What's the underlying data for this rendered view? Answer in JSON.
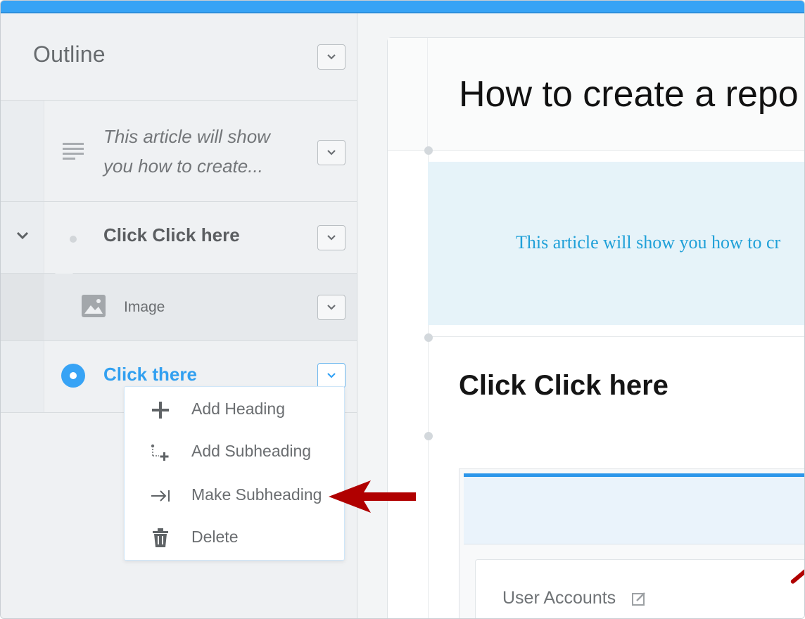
{
  "sidebar": {
    "title": "Outline",
    "rows": [
      {
        "label": "This article will show you how to create...",
        "icon": "paragraph-lines-icon"
      },
      {
        "label": "Click Click here",
        "icon": "bullet-dot-icon",
        "expanded": true
      },
      {
        "label": "Image",
        "icon": "image-icon"
      },
      {
        "label": "Click there",
        "icon": "radio-selected-icon",
        "selected": true
      }
    ]
  },
  "menu": {
    "items": [
      {
        "label": "Add Heading",
        "icon": "plus-icon"
      },
      {
        "label": "Add Subheading",
        "icon": "add-subheading-icon"
      },
      {
        "label": "Make Subheading",
        "icon": "indent-arrow-icon"
      },
      {
        "label": "Delete",
        "icon": "trash-icon"
      }
    ]
  },
  "document": {
    "title": "How to create a repo",
    "intro": "This article will show you how to cr",
    "heading": "Click Click here",
    "image_card_label": "User Accounts"
  },
  "colors": {
    "accent": "#37a3f5",
    "selected_text": "#32a0f0",
    "annotation_arrow": "#b00000"
  }
}
